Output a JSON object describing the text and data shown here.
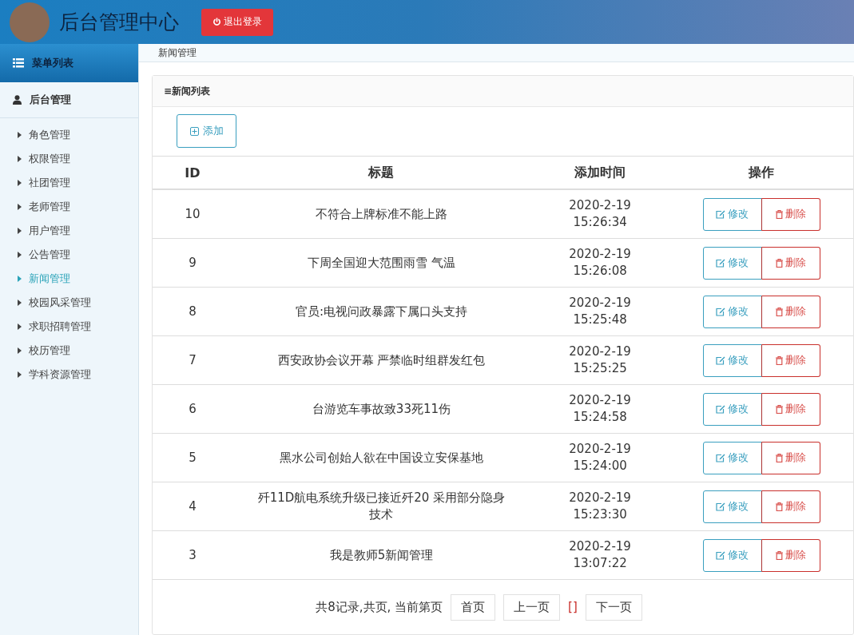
{
  "header": {
    "title": "后台管理中心",
    "logout": "退出登录"
  },
  "sidebar": {
    "heading": "菜单列表",
    "group": "后台管理",
    "items": [
      {
        "label": "角色管理",
        "selected": false
      },
      {
        "label": "权限管理",
        "selected": false
      },
      {
        "label": "社团管理",
        "selected": false
      },
      {
        "label": "老师管理",
        "selected": false
      },
      {
        "label": "用户管理",
        "selected": false
      },
      {
        "label": "公告管理",
        "selected": false
      },
      {
        "label": "新闻管理",
        "selected": true
      },
      {
        "label": "校园风采管理",
        "selected": false
      },
      {
        "label": "求职招聘管理",
        "selected": false
      },
      {
        "label": "校历管理",
        "selected": false
      },
      {
        "label": "学科资源管理",
        "selected": false
      }
    ]
  },
  "breadcrumb": "新闻管理",
  "panel": {
    "title": "≡新闻列表",
    "add_button": "添加"
  },
  "table": {
    "columns": [
      "ID",
      "标题",
      "添加时间",
      "操作"
    ],
    "rows": [
      {
        "id": "10",
        "title": "不符合上牌标准不能上路",
        "date": "2020-2-19",
        "time": "15:26:34",
        "edit": "修改",
        "delete": "删除"
      },
      {
        "id": "9",
        "title": "下周全国迎大范围雨雪 气温",
        "date": "2020-2-19",
        "time": "15:26:08",
        "edit": "修改",
        "delete": "删除"
      },
      {
        "id": "8",
        "title": "官员:电视问政暴露下属口头支持",
        "date": "2020-2-19",
        "time": "15:25:48",
        "edit": "修改",
        "delete": "删除"
      },
      {
        "id": "7",
        "title": "西安政协会议开幕 严禁临时组群发红包",
        "date": "2020-2-19",
        "time": "15:25:25",
        "edit": "修改",
        "delete": "删除"
      },
      {
        "id": "6",
        "title": "台游览车事故致33死11伤",
        "date": "2020-2-19",
        "time": "15:24:58",
        "edit": "修改",
        "delete": "删除"
      },
      {
        "id": "5",
        "title": "黑水公司创始人欲在中国设立安保基地",
        "date": "2020-2-19",
        "time": "15:24:00",
        "edit": "修改",
        "delete": "删除"
      },
      {
        "id": "4",
        "title": "歼11D航电系统升级已接近歼20 采用部分隐身技术",
        "date": "2020-2-19",
        "time": "15:23:30",
        "edit": "修改",
        "delete": "删除"
      },
      {
        "id": "3",
        "title": "我是教师5新闻管理",
        "date": "2020-2-19",
        "time": "13:07:22",
        "edit": "修改",
        "delete": "删除"
      }
    ]
  },
  "pagination": {
    "summary": "共8记录,共页, 当前第页",
    "first": "首页",
    "prev": "上一页",
    "current": "[]",
    "next": "下一页"
  }
}
